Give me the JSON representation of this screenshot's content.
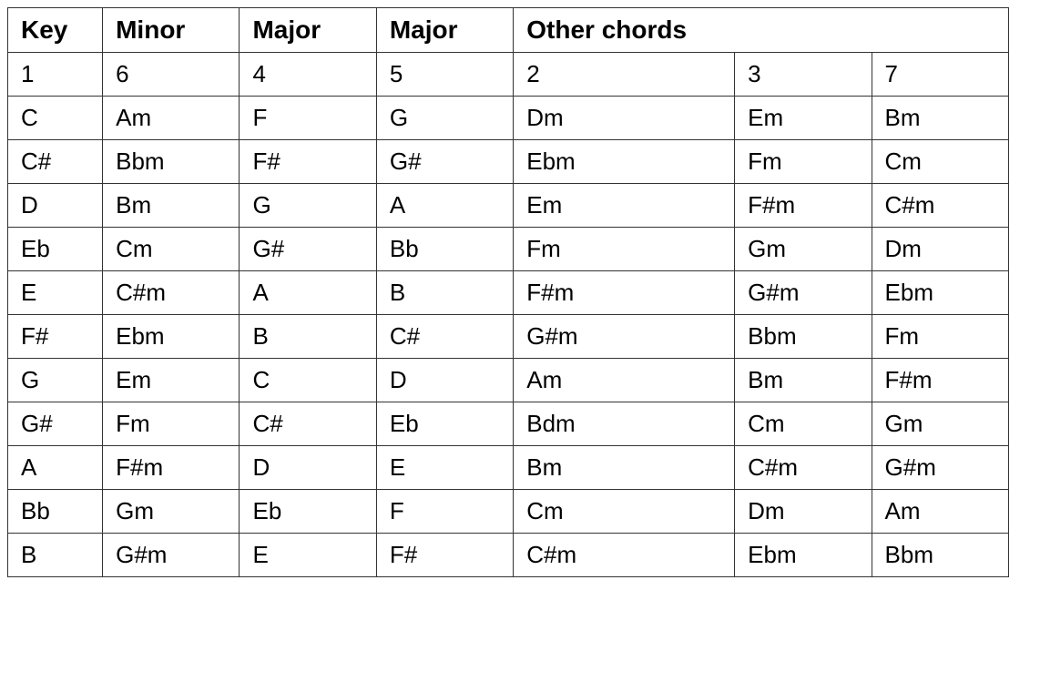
{
  "table": {
    "headers": {
      "key": "Key",
      "minor": "Minor",
      "major1": "Major",
      "major2": "Major",
      "other_chords": "Other chords"
    },
    "subheaders": {
      "one": "1",
      "six": "6",
      "four": "4",
      "five": "5",
      "two": "2",
      "three": "3",
      "seven": "7"
    },
    "rows": [
      {
        "key": "C",
        "minor": "Am",
        "major1": "F",
        "major2": "G",
        "oc2": "Dm",
        "oc3": "Em",
        "oc7": "Bm"
      },
      {
        "key": "C#",
        "minor": "Bbm",
        "major1": "F#",
        "major2": "G#",
        "oc2": "Ebm",
        "oc3": "Fm",
        "oc7": "Cm"
      },
      {
        "key": "D",
        "minor": "Bm",
        "major1": "G",
        "major2": "A",
        "oc2": "Em",
        "oc3": "F#m",
        "oc7": "C#m"
      },
      {
        "key": "Eb",
        "minor": "Cm",
        "major1": "G#",
        "major2": "Bb",
        "oc2": "Fm",
        "oc3": "Gm",
        "oc7": "Dm"
      },
      {
        "key": "E",
        "minor": "C#m",
        "major1": "A",
        "major2": "B",
        "oc2": "F#m",
        "oc3": "G#m",
        "oc7": "Ebm"
      },
      {
        "key": "F#",
        "minor": "Ebm",
        "major1": "B",
        "major2": "C#",
        "oc2": "G#m",
        "oc3": "Bbm",
        "oc7": "Fm"
      },
      {
        "key": "G",
        "minor": "Em",
        "major1": "C",
        "major2": "D",
        "oc2": "Am",
        "oc3": "Bm",
        "oc7": "F#m"
      },
      {
        "key": "G#",
        "minor": "Fm",
        "major1": "C#",
        "major2": "Eb",
        "oc2": "Bdm",
        "oc3": "Cm",
        "oc7": "Gm"
      },
      {
        "key": "A",
        "minor": "F#m",
        "major1": "D",
        "major2": "E",
        "oc2": "Bm",
        "oc3": "C#m",
        "oc7": "G#m"
      },
      {
        "key": "Bb",
        "minor": "Gm",
        "major1": "Eb",
        "major2": "F",
        "oc2": "Cm",
        "oc3": "Dm",
        "oc7": "Am"
      },
      {
        "key": "B",
        "minor": "G#m",
        "major1": "E",
        "major2": "F#",
        "oc2": "C#m",
        "oc3": "Ebm",
        "oc7": "Bbm"
      }
    ]
  }
}
